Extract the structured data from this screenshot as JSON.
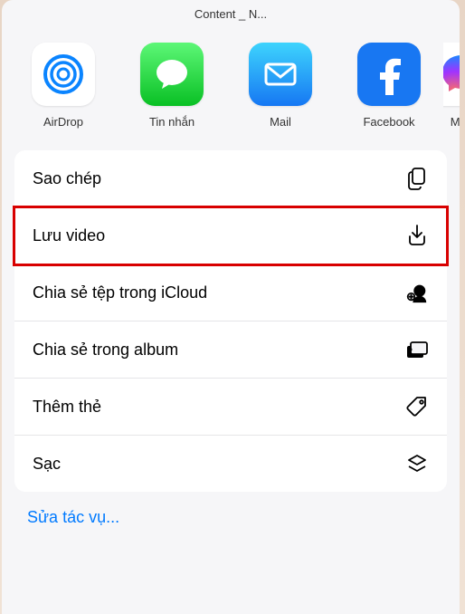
{
  "header": {
    "title": "Content _ N..."
  },
  "apps": [
    {
      "name": "airdrop",
      "label": "AirDrop"
    },
    {
      "name": "messages",
      "label": "Tin nhắn"
    },
    {
      "name": "mail",
      "label": "Mail"
    },
    {
      "name": "facebook",
      "label": "Facebook"
    },
    {
      "name": "messenger",
      "label": "Mes"
    }
  ],
  "actions": [
    {
      "key": "copy",
      "label": "Sao chép",
      "icon": "copy-icon",
      "highlight": false
    },
    {
      "key": "save-video",
      "label": "Lưu video",
      "icon": "download-icon",
      "highlight": true
    },
    {
      "key": "share-icloud",
      "label": "Chia sẻ tệp trong iCloud",
      "icon": "icloud-share-icon",
      "highlight": false
    },
    {
      "key": "share-album",
      "label": "Chia sẻ trong album",
      "icon": "album-icon",
      "highlight": false
    },
    {
      "key": "add-tag",
      "label": "Thêm thẻ",
      "icon": "tag-icon",
      "highlight": false
    },
    {
      "key": "stack",
      "label": "Sạc",
      "icon": "stack-icon",
      "highlight": false
    }
  ],
  "edit": {
    "label": "Sửa tác vụ..."
  }
}
